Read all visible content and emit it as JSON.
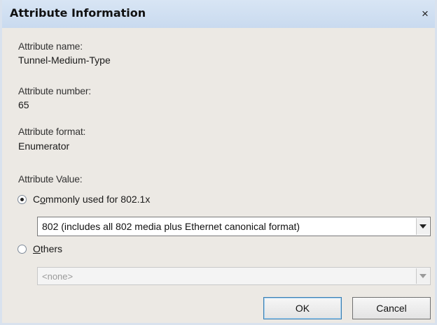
{
  "window": {
    "title": "Attribute Information",
    "close_glyph": "×"
  },
  "fields": {
    "name_label": "Attribute name:",
    "name_value": "Tunnel-Medium-Type",
    "number_label": "Attribute number:",
    "number_value": "65",
    "format_label": "Attribute format:",
    "format_value": "Enumerator"
  },
  "attribute_value": {
    "label": "Attribute Value:",
    "option_common": {
      "label_access_key": "o",
      "label_prefix": "C",
      "label_rest": "mmonly used for 802.1x",
      "selected": true
    },
    "common_select": {
      "value": "802 (includes all 802 media plus Ethernet canonical format)"
    },
    "option_others": {
      "label_access_key": "O",
      "label_rest": "thers",
      "selected": false
    },
    "others_select": {
      "value": "<none>",
      "disabled": true
    }
  },
  "buttons": {
    "ok": "OK",
    "cancel": "Cancel"
  }
}
